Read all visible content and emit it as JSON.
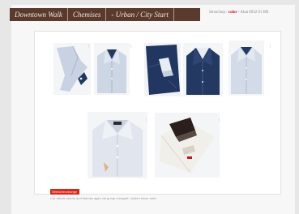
{
  "nav": {
    "tabs": [
      {
        "label": "Downtown Walk"
      },
      {
        "label": "Chemises"
      },
      {
        "label": "- Urban / City Start"
      }
    ]
  },
  "header": {
    "left": "Stroschop /",
    "highlight": "color",
    "right": "/ Akat 0932 01 RR"
  },
  "gallery": {
    "items": [
      {
        "name": "shirt-photo-1"
      },
      {
        "name": "shirt-photo-2"
      },
      {
        "name": "shirt-photo-3"
      },
      {
        "name": "shirt-photo-4"
      },
      {
        "name": "shirt-photo-5"
      },
      {
        "name": "shirt-photo-6"
      },
      {
        "name": "shirt-photo-7"
      }
    ]
  },
  "footer": {
    "button_label": "Stretch/exchange",
    "note": "Car attude eturns and themes ages val group rcsisgmt / anded fense reter"
  },
  "colors": {
    "nav_bg": "#5a3a2c",
    "accent_red": "#d8261d",
    "shirt_light": "#c9d3e3",
    "shirt_navy": "#253a63"
  }
}
